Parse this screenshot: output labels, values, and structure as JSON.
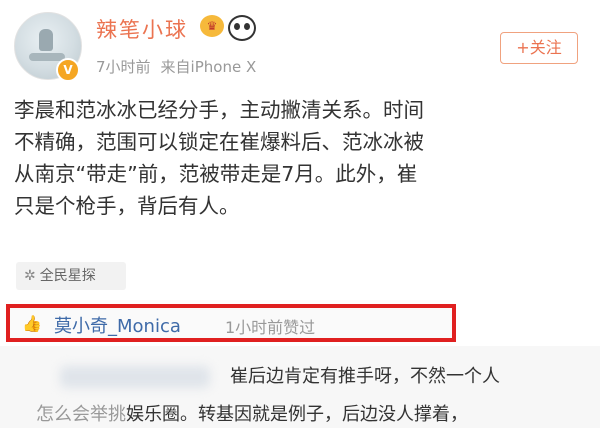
{
  "post": {
    "username": "辣笔小球",
    "time": "7小时前",
    "source": "来自iPhone X",
    "follow_label": "+关注",
    "content_lines": [
      "李晨和范冰冰已经分手，主动撇清关系。时间",
      "不精确，范围可以锁定在崔爆料后、范冰冰被",
      "从南京“带走”前，范被带走是7月。此外，崔",
      "只是个枪手，背后有人。"
    ],
    "tag": {
      "icon": "sparkle-icon",
      "label": "全民星探"
    }
  },
  "like": {
    "icon": "thumbs-up-icon",
    "name": "莫小奇_Monica",
    "time_text": "1小时前赞过",
    "highlight_color": "#e02020"
  },
  "comment": {
    "line1": "崔后边肯定有推手呀，不然一个人",
    "line2_faded": "怎么会举挑",
    "line2": "娱乐圈。转基因就是例子，后边没人撑着，"
  },
  "colors": {
    "username": "#eb7350",
    "link": "#3e6aa8"
  }
}
